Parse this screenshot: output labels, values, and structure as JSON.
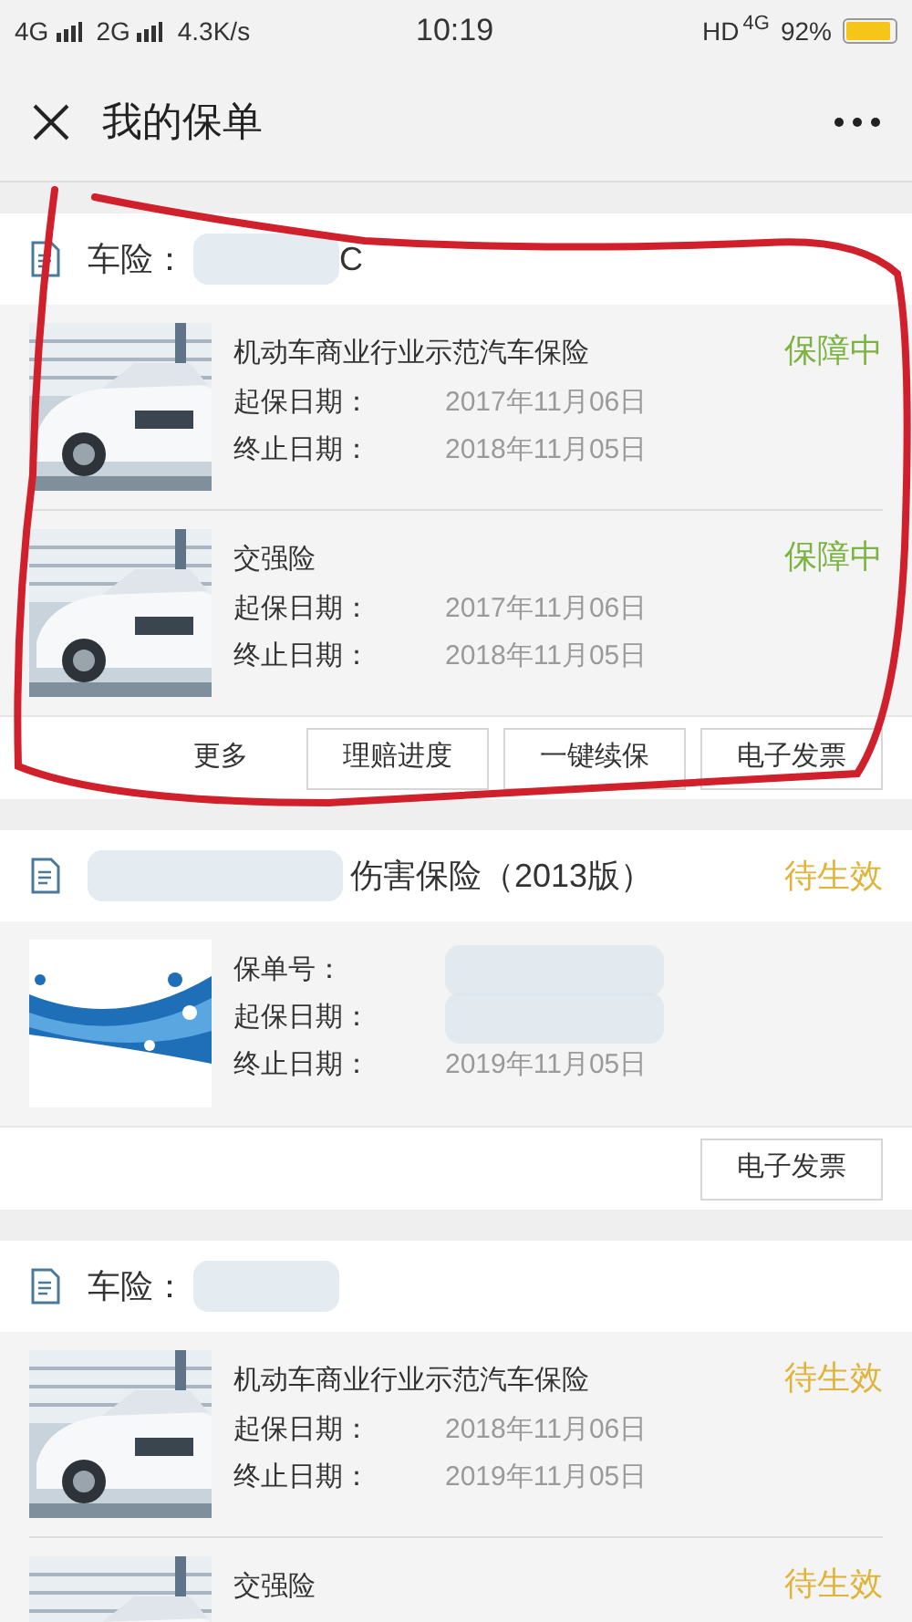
{
  "status_bar": {
    "left": [
      {
        "text": "4G",
        "kind": "signal"
      },
      {
        "text": "2G",
        "kind": "signal"
      },
      {
        "text": "4.3K/s",
        "kind": "plain"
      }
    ],
    "time": "10:19",
    "hd": "HD",
    "network": "4G",
    "battery": "92%"
  },
  "header": {
    "title": "我的保单"
  },
  "cards": [
    {
      "title": "车险：",
      "title_redacted": true,
      "title_tail": "C",
      "policies": [
        {
          "name": "机动车商业行业示范汽车保险",
          "status": {
            "text": "保障中",
            "color": "#7cb342"
          },
          "rows": [
            {
              "label": "起保日期：",
              "value": "2017年11月06日"
            },
            {
              "label": "终止日期：",
              "value": "2018年11月05日"
            }
          ]
        },
        {
          "name": "交强险",
          "status": {
            "text": "保障中",
            "color": "#7cb342"
          },
          "rows": [
            {
              "label": "起保日期：",
              "value": "2017年11月06日"
            },
            {
              "label": "终止日期：",
              "value": "2018年11月05日"
            }
          ]
        }
      ],
      "buttons": [
        {
          "label": "更多",
          "kind": "link"
        },
        {
          "label": "理赔进度",
          "kind": "button"
        },
        {
          "label": "一键续保",
          "kind": "button"
        },
        {
          "label": "电子发票",
          "kind": "button"
        }
      ]
    },
    {
      "title": "伤害保险（2013版）",
      "title_redacted": true,
      "status": {
        "text": "待生效",
        "color": "#e0b43a"
      },
      "policies": [
        {
          "rows": [
            {
              "label": "保单号：",
              "redacted": true
            },
            {
              "label": "起保日期：",
              "redacted": true
            },
            {
              "label": "终止日期：",
              "value": "2019年11月05日"
            }
          ]
        }
      ],
      "buttons": [
        {
          "label": "电子发票",
          "kind": "button"
        }
      ]
    },
    {
      "title": "车险：",
      "title_redacted": true,
      "policies": [
        {
          "name": "机动车商业行业示范汽车保险",
          "status": {
            "text": "待生效",
            "color": "#e0b43a"
          },
          "rows": [
            {
              "label": "起保日期：",
              "value": "2018年11月06日"
            },
            {
              "label": "终止日期：",
              "value": "2019年11月05日"
            }
          ]
        },
        {
          "name": "交强险",
          "status": {
            "text": "待生效",
            "color": "#e0b43a"
          }
        }
      ]
    }
  ]
}
